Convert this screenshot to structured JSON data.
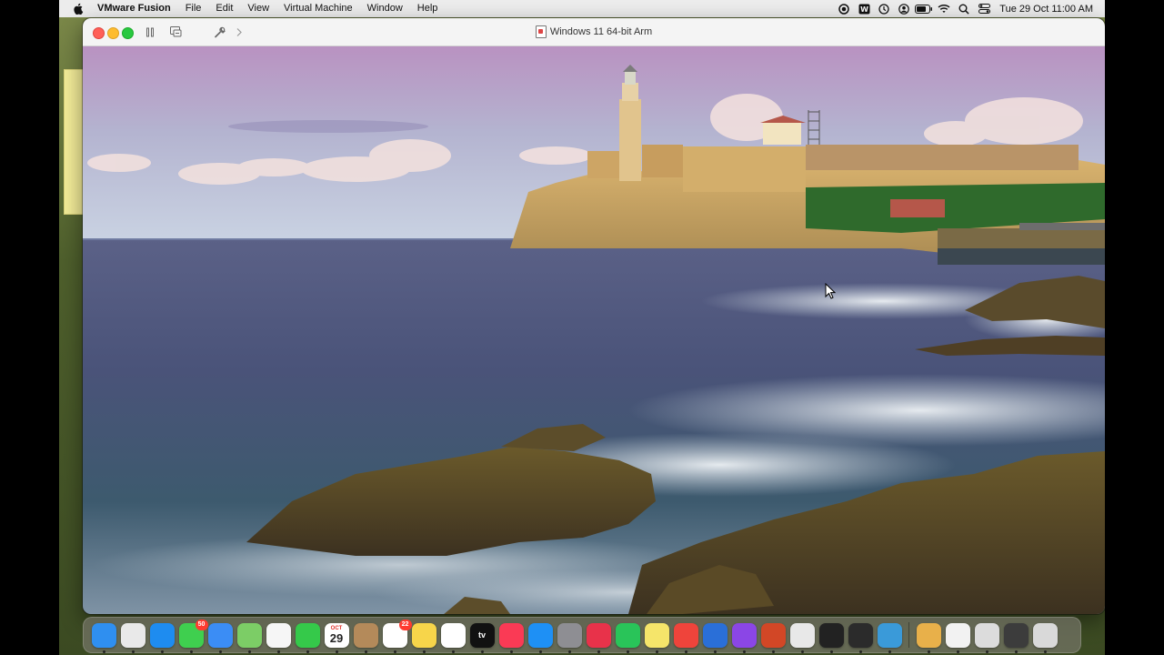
{
  "menubar": {
    "app_name": "VMware Fusion",
    "menus": [
      "File",
      "Edit",
      "View",
      "Virtual Machine",
      "Window",
      "Help"
    ],
    "status_icons": [
      "record-icon",
      "wps-icon",
      "time-machine-icon",
      "user-icon",
      "battery-icon",
      "wifi-icon",
      "search-icon",
      "control-center-icon"
    ],
    "clock": "Tue 29 Oct  11:00 AM"
  },
  "window": {
    "title": "Windows 11 64-bit Arm"
  },
  "dock": {
    "apps": [
      {
        "name": "finder-icon",
        "color": "#2f8ff0"
      },
      {
        "name": "launchpad-icon",
        "color": "#e9e9e9"
      },
      {
        "name": "safari-icon",
        "color": "#1e8cf0"
      },
      {
        "name": "messages-icon",
        "color": "#3fcf4f",
        "badge": "50"
      },
      {
        "name": "mail-icon",
        "color": "#3b8df5"
      },
      {
        "name": "maps-icon",
        "color": "#7ccd66"
      },
      {
        "name": "photos-icon",
        "color": "#f6f6f6"
      },
      {
        "name": "facetime-icon",
        "color": "#35c94a"
      },
      {
        "name": "calendar-icon",
        "color": "#ffffff",
        "month": "OCT",
        "day": "29"
      },
      {
        "name": "contacts-icon",
        "color": "#b48a5a"
      },
      {
        "name": "reminders-icon",
        "color": "#ffffff",
        "badge": "22"
      },
      {
        "name": "notes-icon",
        "color": "#f7d54a"
      },
      {
        "name": "freeform-icon",
        "color": "#ffffff"
      },
      {
        "name": "apple-tv-icon",
        "color": "#111111",
        "label": "tv"
      },
      {
        "name": "music-icon",
        "color": "#fa3a55"
      },
      {
        "name": "app-store-icon",
        "color": "#1e90f5"
      },
      {
        "name": "system-settings-icon",
        "color": "#8e8e93"
      },
      {
        "name": "wps-office-icon",
        "color": "#e8324a"
      },
      {
        "name": "whatsapp-icon",
        "color": "#29c459"
      },
      {
        "name": "stickies-icon",
        "color": "#f5e56a"
      },
      {
        "name": "anydesk-icon",
        "color": "#ef443b"
      },
      {
        "name": "remote-desktop-icon",
        "color": "#2a6fd8"
      },
      {
        "name": "wps-writer-icon",
        "color": "#8b46e6"
      },
      {
        "name": "powerpoint-icon",
        "color": "#d24726"
      },
      {
        "name": "script-editor-icon",
        "color": "#e8e8e8"
      },
      {
        "name": "terminal-icon",
        "color": "#222222"
      },
      {
        "name": "final-cut-icon",
        "color": "#2b2b2b"
      },
      {
        "name": "quicktime-icon",
        "color": "#3a9ad9"
      }
    ],
    "folders": [
      {
        "name": "downloads-stack-icon",
        "color": "#e8b04a"
      },
      {
        "name": "document-stack-icon",
        "color": "#f2f2f2"
      },
      {
        "name": "recent-stack-icon",
        "color": "#dcdcdc"
      },
      {
        "name": "screen-stack-icon",
        "color": "#3c3c3c"
      },
      {
        "name": "trash-icon",
        "color": "#d9d9d9"
      }
    ]
  }
}
